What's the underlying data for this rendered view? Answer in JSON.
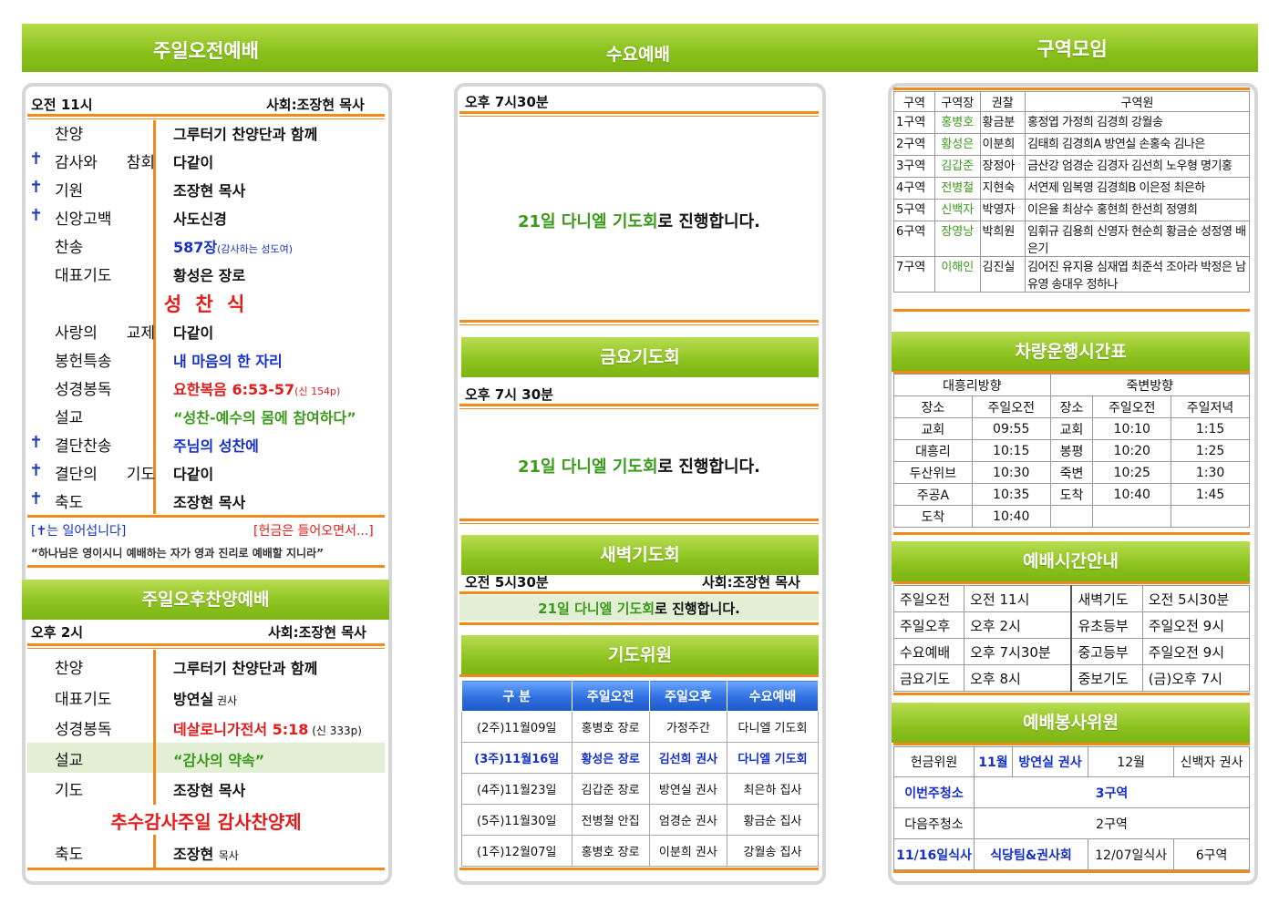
{
  "header": {
    "col1": "주일오전예배",
    "col2": "수요예배",
    "col3": "구역모임"
  },
  "morning": {
    "time": "오전 11시",
    "host": "사회:조장현 목사",
    "items": [
      {
        "cross": "",
        "label": "찬양",
        "value": "그루터기 찬양단과 함께",
        "color": "#111"
      },
      {
        "cross": "✝",
        "label": "감사와 참회",
        "value": "다같이",
        "color": "#111"
      },
      {
        "cross": "✝",
        "label": "기원",
        "value": "조장현 목사",
        "color": "#111"
      },
      {
        "cross": "✝",
        "label": "신앙고백",
        "value": "사도신경",
        "color": "#111"
      },
      {
        "cross": "",
        "label": "찬송",
        "value": "587장",
        "note": "(감사하는 성도여)",
        "color": "#1530c8"
      },
      {
        "cross": "",
        "label": "대표기도",
        "value": "황성은 장로",
        "color": "#111"
      }
    ],
    "sacrament": "성 찬 식",
    "items2": [
      {
        "cross": "",
        "label": "사랑의 교제",
        "value": "다같이",
        "color": "#111"
      },
      {
        "cross": "",
        "label": "봉헌특송",
        "value": "내 마음의 한 자리",
        "color": "#1530c8"
      },
      {
        "cross": "",
        "label": "성경봉독",
        "value": "요한복음 6:53-57",
        "note": "(신 154p)",
        "color": "#e51a1a"
      },
      {
        "cross": "",
        "label": "설교",
        "value": "“성찬-예수의 몸에 참여하다”",
        "color": "#3a9a1a"
      },
      {
        "cross": "✝",
        "label": "결단찬송",
        "value": "주님의 성찬에",
        "color": "#1530c8"
      },
      {
        "cross": "✝",
        "label": "결단의 기도",
        "value": "다같이",
        "color": "#111"
      },
      {
        "cross": "✝",
        "label": "축도",
        "value": "조장현 목사",
        "color": "#111"
      }
    ],
    "note_left": "[✝는 일어섭니다]",
    "note_right": "[헌금은 들어오면서...]",
    "verse": "“하나님은 영이시니 예배하는 자가 영과 진리로 예배할 지니라”"
  },
  "afternoon": {
    "title": "주일오후찬양예배",
    "time": "오후 2시",
    "host": "사회:조장현 목사",
    "items": [
      {
        "label": "찬양",
        "value": "그루터기 찬양단과 함께",
        "color": "#111"
      },
      {
        "label": "대표기도",
        "value": "방연실",
        "note": "권사",
        "color": "#111"
      },
      {
        "label": "성경봉독",
        "value": "데살로니가전서 5:18",
        "note": "(신 333p)",
        "color": "#e51a1a"
      },
      {
        "label": "설교",
        "value": "“감사의 약속”",
        "color": "#3a9a1a"
      },
      {
        "label": "기도",
        "value": "조장현 목사",
        "color": "#111"
      }
    ],
    "event": "추수감사주일 감사찬양제",
    "last": {
      "label": "축도",
      "value": "조장현",
      "note": "목사"
    }
  },
  "wednesday": {
    "time": "오후 7시30분",
    "msg_a": "21일 다니엘 기도회",
    "msg_b": "로 진행합니다."
  },
  "friday": {
    "title": "금요기도회",
    "time": "오후 7시 30분",
    "msg_a": "21일 다니엘 기도회",
    "msg_b": "로 진행합니다."
  },
  "dawn": {
    "title": "새벽기도회",
    "time": "오전 5시30분",
    "host": "사회:조장현 목사",
    "msg_a": "21일 다니엘 기도회",
    "msg_b": "로 진행합니다."
  },
  "prayer_committee": {
    "title": "기도위원",
    "headers": [
      "구 분",
      "주일오전",
      "주일오후",
      "수요예배"
    ],
    "rows": [
      [
        "(2주)11월09일",
        "홍병호 장로",
        "가정주간",
        "다니엘 기도회"
      ],
      [
        "(3주)11월16일",
        "황성은 장로",
        "김선희 권사",
        "다니엘 기도회"
      ],
      [
        "(4주)11월23일",
        "김갑준 장로",
        "방연실 권사",
        "최은하 집사"
      ],
      [
        "(5주)11월30일",
        "전병철 안집",
        "엄경순 권사",
        "황금순 집사"
      ],
      [
        "(1주)12월07일",
        "홍병호 장로",
        "이분희 권사",
        "강월송 집사"
      ]
    ]
  },
  "cell": {
    "headers": [
      "구역",
      "구역장",
      "권찰",
      "구역원"
    ],
    "rows": [
      [
        "1구역",
        "홍병호",
        "황금분",
        "홍정엽 가정희 김경희 강월송"
      ],
      [
        "2구역",
        "황성은",
        "이분희",
        "김태희 김경희A 방연실 손홍숙 김나은"
      ],
      [
        "3구역",
        "김갑준",
        "장정아",
        "금산강 엄경순 김경자 김선희 노우형 명기홍"
      ],
      [
        "4구역",
        "전병철",
        "지현숙",
        "서연제 임복영 김경희B 이은정 최은하"
      ],
      [
        "5구역",
        "신백자",
        "박영자",
        "이은율 최상수 홍현희 한선희 정영희"
      ],
      [
        "6구역",
        "장영낭",
        "박희원",
        "임휘규 김용희 신영자 현순희 황금순 성정영 배은기"
      ],
      [
        "7구역",
        "이해인",
        "김진실",
        "김어진 유지용 심재엽 최준석 조아라 박정은 남유영 송대우 정하나"
      ]
    ]
  },
  "bus": {
    "title": "차량운행시간표",
    "dir1": "대흥리방향",
    "dir2": "죽변방향",
    "headers": [
      "장소",
      "주일오전",
      "장소",
      "주일오전",
      "주일저녁"
    ],
    "rows": [
      [
        "교회",
        "09:55",
        "교회",
        "10:10",
        "1:15"
      ],
      [
        "대흥리",
        "10:15",
        "봉평",
        "10:20",
        "1:25"
      ],
      [
        "두산위브",
        "10:30",
        "죽변",
        "10:25",
        "1:30"
      ],
      [
        "주공A",
        "10:35",
        "도착",
        "10:40",
        "1:45"
      ],
      [
        "도착",
        "10:40",
        "",
        "",
        ""
      ]
    ]
  },
  "service_times": {
    "title": "예배시간안내",
    "rows": [
      [
        "주일오전",
        "오전 11시",
        "새벽기도",
        "오전 5시30분"
      ],
      [
        "주일오후",
        "오후 2시",
        "유초등부",
        "주일오전 9시"
      ],
      [
        "수요예배",
        "오후 7시30분",
        "중고등부",
        "주일오전 9시"
      ],
      [
        "금요기도",
        "오후 8시",
        "중보기도",
        "(금)오후 7시"
      ]
    ]
  },
  "service_committee": {
    "title": "예배봉사위원",
    "r1": [
      "헌금위원",
      "11월",
      "방연실 권사",
      "12월",
      "신백자 권사"
    ],
    "r2": [
      "이번주청소",
      "3구역"
    ],
    "r3": [
      "다음주청소",
      "2구역"
    ],
    "r4": [
      "11/16일식사",
      "식당팀&권사회",
      "12/07일식사",
      "6구역"
    ]
  }
}
